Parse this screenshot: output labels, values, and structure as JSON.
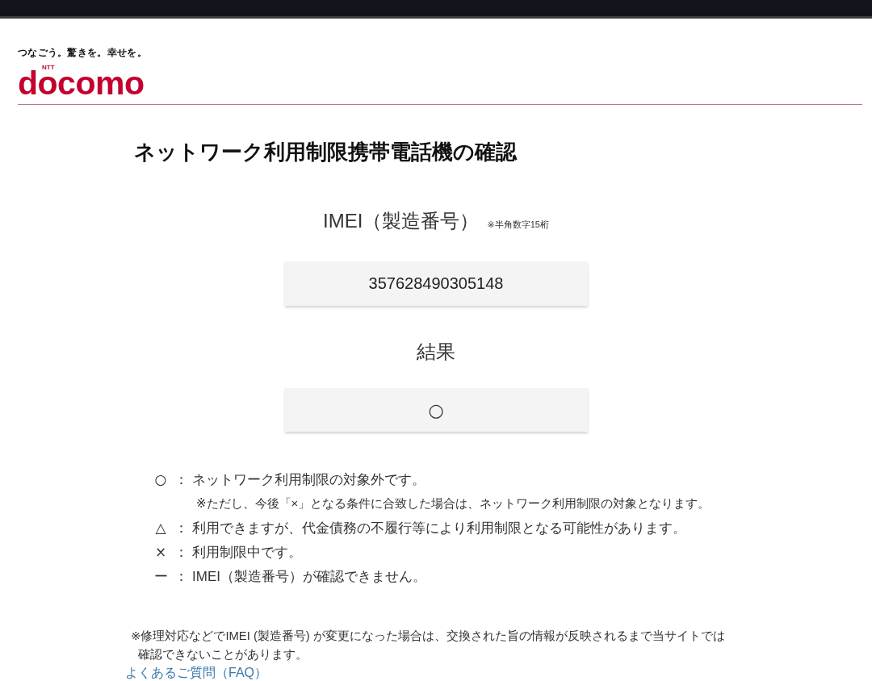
{
  "header": {
    "tagline": "つなごう。驚きを。幸せを。",
    "logo": {
      "brand_small": "NTT",
      "brand": "docomo"
    }
  },
  "title": "ネットワーク利用制限携帯電話機の確認",
  "imei": {
    "label": "IMEI（製造番号）",
    "hint": "※半角数字15桁",
    "value": "357628490305148"
  },
  "result": {
    "label": "結果",
    "value": "○"
  },
  "legend": [
    {
      "symbol": "○",
      "separator": "：",
      "text": "ネットワーク利用制限の対象外です。",
      "note": "※ただし、今後「×」となる条件に合致した場合は、ネットワーク利用制限の対象となります。"
    },
    {
      "symbol": "△",
      "separator": "：",
      "text": "利用できますが、代金債務の不履行等により利用制限となる可能性があります。"
    },
    {
      "symbol": "×",
      "separator": "：",
      "text": "利用制限中です。"
    },
    {
      "symbol": "ー",
      "separator": "：",
      "text": "IMEI（製造番号）が確認できません。"
    }
  ],
  "footnote": "※修理対応などでIMEI (製造番号) が変更になった場合は、交換された旨の情報が反映されるまで当サイトでは確認できないことがあります。",
  "links": [
    {
      "label": "よくあるご質問（FAQ）"
    }
  ]
}
